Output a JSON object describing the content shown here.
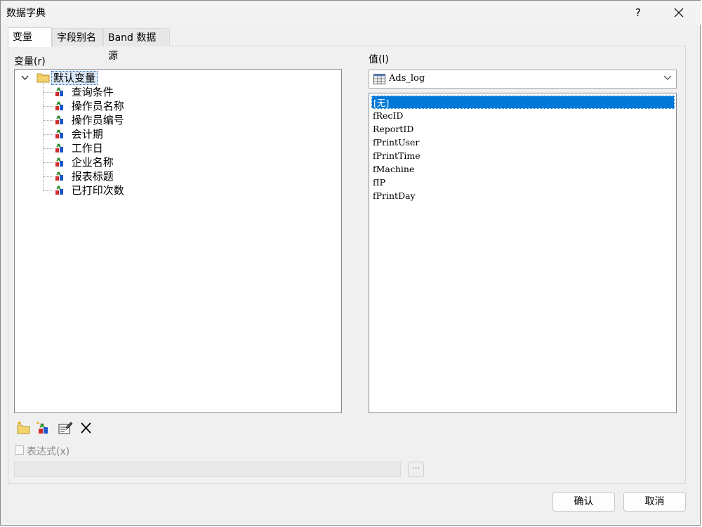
{
  "window": {
    "title": "数据字典",
    "help_label": "?"
  },
  "tabs": [
    {
      "label": "变量"
    },
    {
      "label": "字段别名"
    },
    {
      "label": "Band 数据源"
    }
  ],
  "variables_panel": {
    "label": "变量(r)",
    "root": {
      "label": "默认变量"
    },
    "items": [
      {
        "label": "查询条件"
      },
      {
        "label": "操作员名称"
      },
      {
        "label": "操作员编号"
      },
      {
        "label": "会计期"
      },
      {
        "label": "工作日"
      },
      {
        "label": "企业名称"
      },
      {
        "label": "报表标题"
      },
      {
        "label": "已打印次数"
      }
    ]
  },
  "value_panel": {
    "label": "值(l)",
    "datasource_selected": "Ads_log",
    "fields": [
      {
        "label": "[无]",
        "selected": true
      },
      {
        "label": "fRecID"
      },
      {
        "label": "ReportID"
      },
      {
        "label": "fPrintUser"
      },
      {
        "label": "fPrintTime"
      },
      {
        "label": "fMachine"
      },
      {
        "label": "fIP"
      },
      {
        "label": "fPrintDay"
      }
    ]
  },
  "expression": {
    "label": "表达式(x)",
    "value": "",
    "ellipsis_label": "···",
    "checked": false
  },
  "buttons": {
    "ok_label": "确认",
    "cancel_label": "取消"
  },
  "colors": {
    "selection": "#0078d7",
    "folder": "#f3d36b",
    "variable_icon_red": "#d22b2b",
    "variable_icon_blue": "#2255cc"
  }
}
